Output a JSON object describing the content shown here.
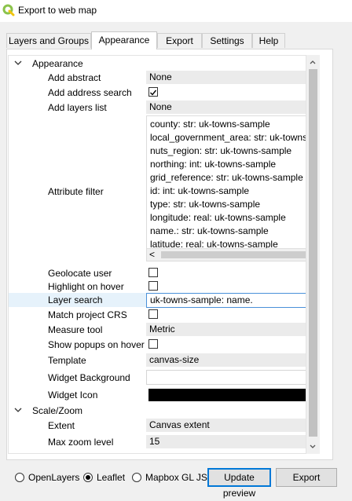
{
  "window": {
    "title": "Export to web map"
  },
  "tabs": [
    {
      "label": "Layers and Groups"
    },
    {
      "label": "Appearance"
    },
    {
      "label": "Export"
    },
    {
      "label": "Settings"
    },
    {
      "label": "Help"
    }
  ],
  "active_tab": "Appearance",
  "appearance": {
    "section_label": "Appearance",
    "add_abstract": {
      "label": "Add abstract",
      "value": "None"
    },
    "add_address_search": {
      "label": "Add address search",
      "checked": true
    },
    "add_layers_list": {
      "label": "Add layers list",
      "value": "None"
    },
    "attribute_filter": {
      "label": "Attribute filter",
      "items": [
        "county: str: uk-towns-sample",
        "local_government_area: str: uk-towns-sample",
        "nuts_region: str: uk-towns-sample",
        "northing: int: uk-towns-sample",
        "grid_reference: str: uk-towns-sample",
        "id: int: uk-towns-sample",
        "type: str: uk-towns-sample",
        "longitude: real: uk-towns-sample",
        "name.: str: uk-towns-sample",
        "latitude: real: uk-towns-sample"
      ],
      "scroll_left_glyph": "<"
    },
    "geolocate_user": {
      "label": "Geolocate user",
      "checked": false
    },
    "highlight_on_hover": {
      "label": "Highlight on hover",
      "checked": false
    },
    "layer_search": {
      "label": "Layer search",
      "value": "uk-towns-sample: name."
    },
    "match_project_crs": {
      "label": "Match project CRS",
      "checked": false
    },
    "measure_tool": {
      "label": "Measure tool",
      "value": "Metric"
    },
    "show_popups_on_hover": {
      "label": "Show popups on hover",
      "checked": false
    },
    "template": {
      "label": "Template",
      "value": "canvas-size"
    },
    "widget_background": {
      "label": "Widget Background",
      "value": ""
    },
    "widget_icon": {
      "label": "Widget Icon",
      "color": "#000000"
    }
  },
  "scale_zoom": {
    "section_label": "Scale/Zoom",
    "extent": {
      "label": "Extent",
      "value": "Canvas extent"
    },
    "max_zoom_level": {
      "label": "Max zoom level",
      "value": "15"
    }
  },
  "bottom": {
    "radios": [
      {
        "label": "OpenLayers",
        "checked": false
      },
      {
        "label": "Leaflet",
        "checked": true
      },
      {
        "label": "Mapbox GL JS",
        "checked": false
      }
    ],
    "update_preview_label": "Update preview",
    "export_label": "Export"
  },
  "colors": {
    "highlight": "#e6f2fb",
    "focus_border": "#0078d7",
    "qgis_green": "#8bc34a"
  }
}
